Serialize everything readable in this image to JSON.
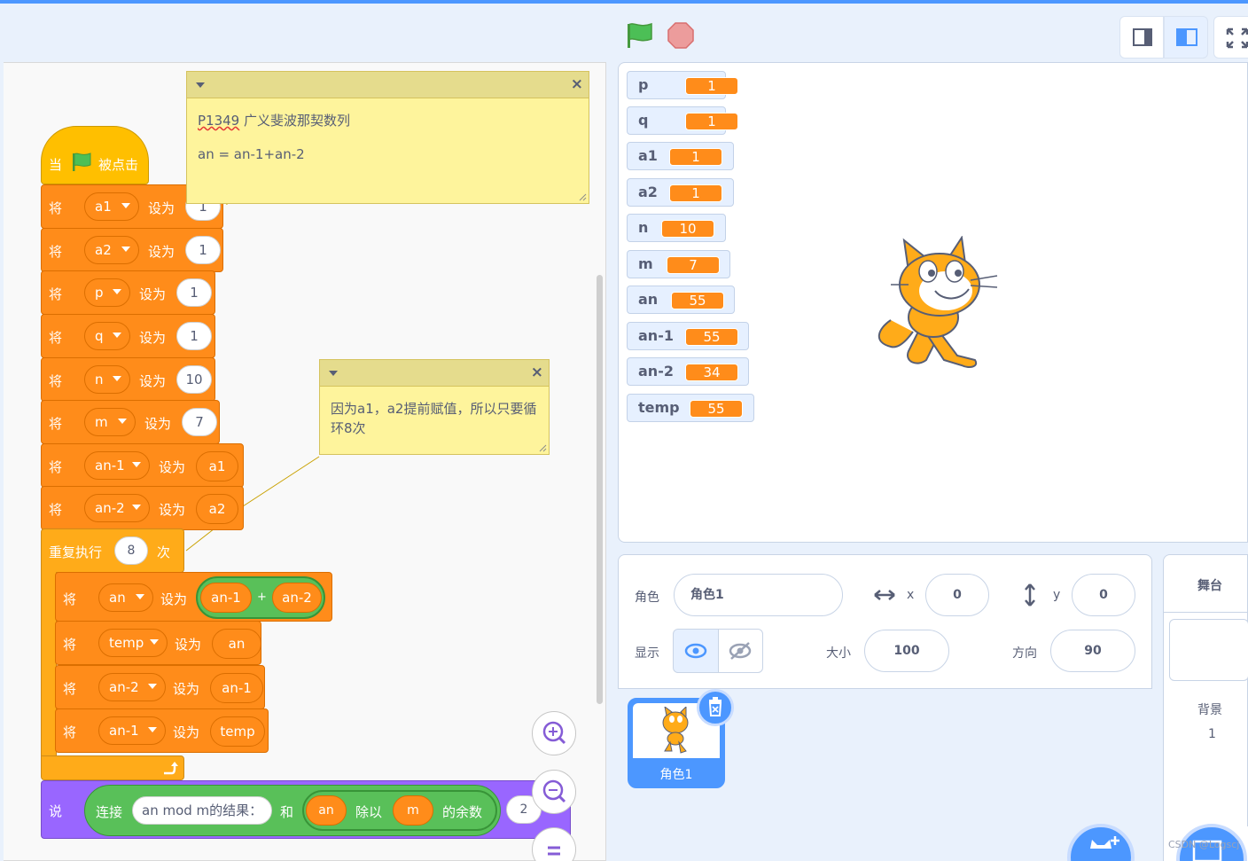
{
  "toolbar": {
    "green_flag": "green-flag-icon",
    "stop": "stop-icon",
    "layout_buttons": [
      "small-stage-icon",
      "normal-stage-icon",
      "fullscreen-icon"
    ]
  },
  "notes": [
    {
      "title": "P1349",
      "line1": "广义斐波那契数列",
      "line2": "an = an-1+an-2"
    },
    {
      "text": "因为a1，a2提前赋值，所以只要循环8次"
    }
  ],
  "script": {
    "hat": {
      "when": "当",
      "clicked": "被点击"
    },
    "set_kw": "将",
    "to_kw": "设为",
    "sets": [
      {
        "var": "a1",
        "value": "1"
      },
      {
        "var": "a2",
        "value": "1"
      },
      {
        "var": "p",
        "value": "1"
      },
      {
        "var": "q",
        "value": "1"
      },
      {
        "var": "n",
        "value": "10"
      },
      {
        "var": "m",
        "value": "7"
      },
      {
        "var": "an-1",
        "value": "a1"
      },
      {
        "var": "an-2",
        "value": "a2"
      }
    ],
    "repeat": {
      "label": "重复执行",
      "count": "8",
      "times": "次"
    },
    "inner": [
      {
        "var": "an",
        "left": "an-1",
        "op": "+",
        "right": "an-2"
      },
      {
        "var": "temp",
        "value": "an"
      },
      {
        "var": "an-2",
        "value": "an-1"
      },
      {
        "var": "an-1",
        "value": "temp"
      }
    ],
    "say": {
      "kw": "说",
      "join": "连接",
      "text": "an mod m的结果：",
      "and": "和",
      "mod_a": "an",
      "mod_kw": "除以",
      "mod_b": "m",
      "mod_tail": "的余数",
      "secs": "2"
    }
  },
  "zoom": {
    "in": "zoom-in-icon",
    "out": "zoom-out-icon",
    "reset": "zoom-reset-icon"
  },
  "monitors": [
    {
      "name": "p",
      "value": "1"
    },
    {
      "name": "q",
      "value": "1"
    },
    {
      "name": "a1",
      "value": "1"
    },
    {
      "name": "a2",
      "value": "1"
    },
    {
      "name": "n",
      "value": "10"
    },
    {
      "name": "m",
      "value": "7"
    },
    {
      "name": "an",
      "value": "55"
    },
    {
      "name": "an-1",
      "value": "55"
    },
    {
      "name": "an-2",
      "value": "34"
    },
    {
      "name": "temp",
      "value": "55"
    }
  ],
  "sprite_info": {
    "sprite_label": "角色",
    "sprite_name": "角色1",
    "x_label": "x",
    "x": "0",
    "y_label": "y",
    "y": "0",
    "show_label": "显示",
    "size_label": "大小",
    "size": "100",
    "direction_label": "方向",
    "direction": "90"
  },
  "sprites": [
    {
      "name": "角色1"
    }
  ],
  "stage_pane": {
    "title": "舞台",
    "backdrops_label": "背景",
    "backdrops_count": "1"
  },
  "watermark": "CSDN @Logscj",
  "colors": {
    "motion_var": "#ff8c1a",
    "control": "#ffab19",
    "events": "#ffbf00",
    "looks": "#9966ff",
    "operators": "#59c059",
    "accent": "#4c97ff"
  }
}
